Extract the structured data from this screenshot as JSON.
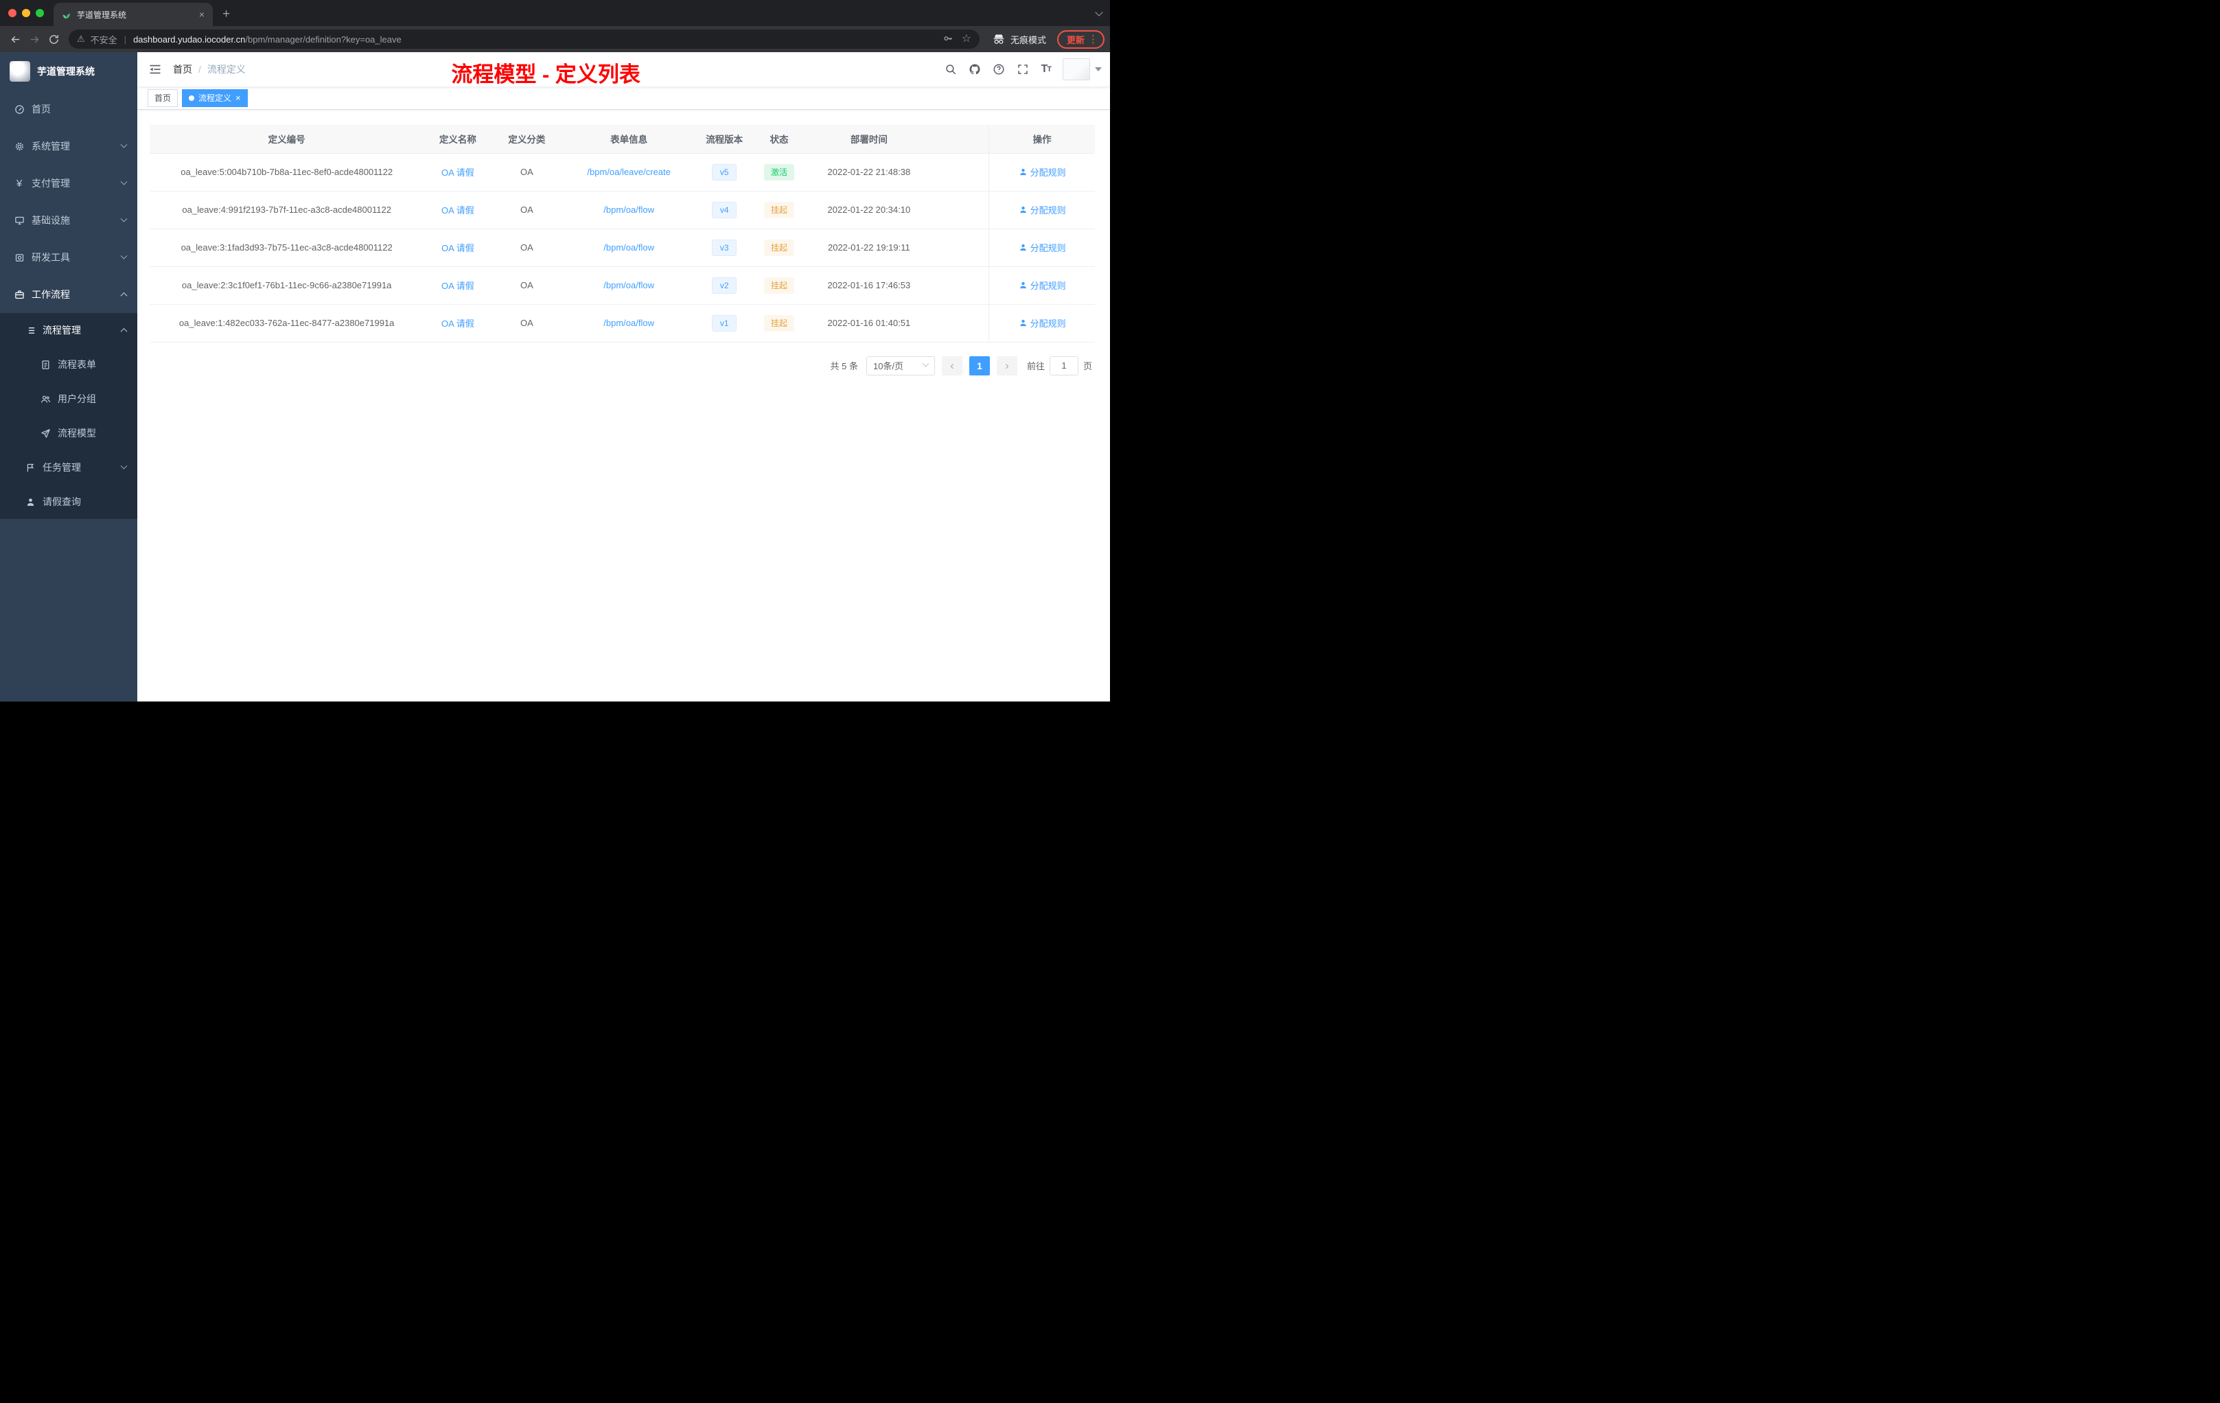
{
  "browser": {
    "tab_title": "芋道管理系统",
    "security_label": "不安全",
    "url_host": "dashboard.yudao.iocoder.cn",
    "url_path": "/bpm/manager/definition?key=oa_leave",
    "incognito_label": "无痕模式",
    "update_label": "更新"
  },
  "sidebar": {
    "logo_title": "芋道管理系统",
    "items": [
      {
        "label": "首页"
      },
      {
        "label": "系统管理"
      },
      {
        "label": "支付管理"
      },
      {
        "label": "基础设施"
      },
      {
        "label": "研发工具"
      },
      {
        "label": "工作流程"
      },
      {
        "label": "流程管理"
      },
      {
        "label": "流程表单"
      },
      {
        "label": "用户分组"
      },
      {
        "label": "流程模型"
      },
      {
        "label": "任务管理"
      },
      {
        "label": "请假查询"
      }
    ]
  },
  "header": {
    "breadcrumb_home": "首页",
    "breadcrumb_sep": "/",
    "breadcrumb_current": "流程定义",
    "annotation": "流程模型 - 定义列表"
  },
  "tags": {
    "home": "首页",
    "current": "流程定义"
  },
  "table": {
    "columns": {
      "id": "定义编号",
      "name": "定义名称",
      "category": "定义分类",
      "form": "表单信息",
      "version": "流程版本",
      "status": "状态",
      "deploy_time": "部署时间",
      "action": "操作"
    },
    "rows": [
      {
        "id": "oa_leave:5:004b710b-7b8a-11ec-8ef0-acde48001122",
        "name": "OA 请假",
        "category": "OA",
        "form": "/bpm/oa/leave/create",
        "version": "v5",
        "status": "激活",
        "deploy_time": "2022-01-22 21:48:38",
        "action": "分配规则"
      },
      {
        "id": "oa_leave:4:991f2193-7b7f-11ec-a3c8-acde48001122",
        "name": "OA 请假",
        "category": "OA",
        "form": "/bpm/oa/flow",
        "version": "v4",
        "status": "挂起",
        "deploy_time": "2022-01-22 20:34:10",
        "action": "分配规则"
      },
      {
        "id": "oa_leave:3:1fad3d93-7b75-11ec-a3c8-acde48001122",
        "name": "OA 请假",
        "category": "OA",
        "form": "/bpm/oa/flow",
        "version": "v3",
        "status": "挂起",
        "deploy_time": "2022-01-22 19:19:11",
        "action": "分配规则"
      },
      {
        "id": "oa_leave:2:3c1f0ef1-76b1-11ec-9c66-a2380e71991a",
        "name": "OA 请假",
        "category": "OA",
        "form": "/bpm/oa/flow",
        "version": "v2",
        "status": "挂起",
        "deploy_time": "2022-01-16 17:46:53",
        "action": "分配规则"
      },
      {
        "id": "oa_leave:1:482ec033-762a-11ec-8477-a2380e71991a",
        "name": "OA 请假",
        "category": "OA",
        "form": "/bpm/oa/flow",
        "version": "v1",
        "status": "挂起",
        "deploy_time": "2022-01-16 01:40:51",
        "action": "分配规则"
      }
    ]
  },
  "pagination": {
    "total": "共 5 条",
    "page_size": "10条/页",
    "current_page": "1",
    "goto_label": "前往",
    "goto_value": "1",
    "page_unit": "页"
  },
  "colors": {
    "accent_blue": "#409eff",
    "success_green": "#13ce66",
    "warning_orange": "#e6a23c",
    "sidebar_bg": "#304156",
    "submenu_bg": "#1f2d3d",
    "annotation_red": "#ff0000"
  }
}
